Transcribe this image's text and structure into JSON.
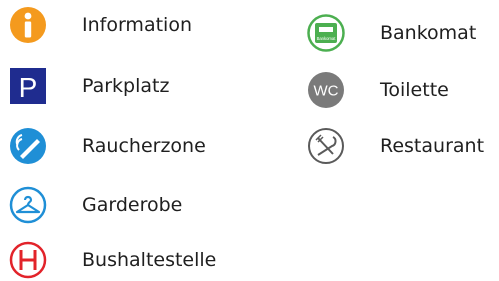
{
  "left_column": [
    {
      "label": "Information",
      "icon": "info-icon",
      "color": "#f49a1e"
    },
    {
      "label": "Parkplatz",
      "icon": "parking-icon",
      "color": "#1f2c8f"
    },
    {
      "label": "Raucherzone",
      "icon": "smoking-icon",
      "color": "#1f8fd6"
    },
    {
      "label": "Garderobe",
      "icon": "hanger-icon",
      "color": "#1f8fd6"
    },
    {
      "label": "Bushaltestelle",
      "icon": "bus-stop-icon",
      "color": "#e2232a"
    }
  ],
  "right_column": [
    {
      "label": "Bankomat",
      "icon": "atm-icon",
      "icon_text": "Bankomat",
      "color": "#4caf50"
    },
    {
      "label": "Toilette",
      "icon": "wc-icon",
      "icon_text": "WC",
      "color": "#7a7a7a"
    },
    {
      "label": "Restaurant",
      "icon": "restaurant-icon",
      "color": "#5a5a5a"
    }
  ]
}
